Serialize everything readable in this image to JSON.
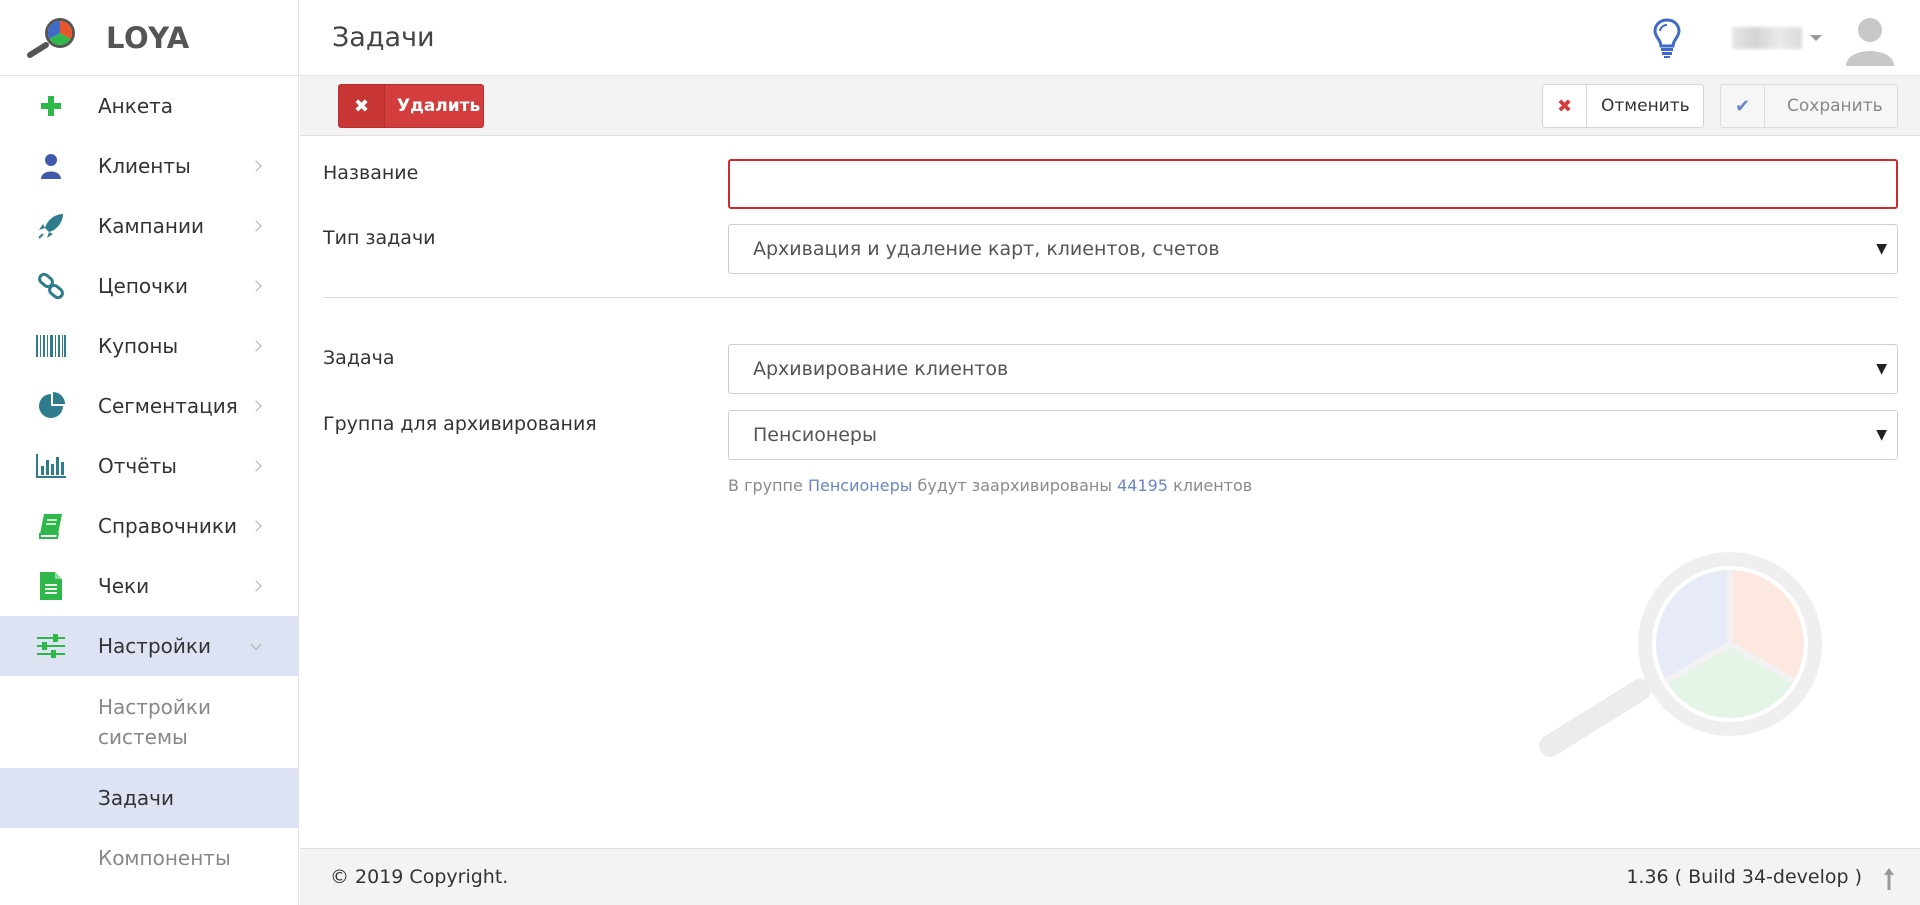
{
  "app": {
    "brand": "LOYA"
  },
  "header": {
    "title": "Задачи"
  },
  "sidebar": {
    "items": [
      {
        "label": "Анкета",
        "icon": "plus-icon",
        "color": "#2fb84a"
      },
      {
        "label": "Клиенты",
        "icon": "user-icon",
        "color": "#3f5aa8"
      },
      {
        "label": "Кампании",
        "icon": "rocket-icon",
        "color": "#2f7d8c"
      },
      {
        "label": "Цепочки",
        "icon": "chain-icon",
        "color": "#2f7d8c"
      },
      {
        "label": "Купоны",
        "icon": "barcode-icon",
        "color": "#2f7d8c"
      },
      {
        "label": "Сегментация",
        "icon": "pie-icon",
        "color": "#2f7d8c"
      },
      {
        "label": "Отчёты",
        "icon": "bar-chart-icon",
        "color": "#2f7d8c"
      },
      {
        "label": "Справочники",
        "icon": "book-icon",
        "color": "#2fb84a"
      },
      {
        "label": "Чеки",
        "icon": "document-icon",
        "color": "#2fb84a"
      },
      {
        "label": "Настройки",
        "icon": "sliders-icon",
        "color": "#2fb84a"
      }
    ],
    "subitems": [
      {
        "label": "Настройки системы"
      },
      {
        "label": "Задачи"
      },
      {
        "label": "Компоненты"
      }
    ]
  },
  "toolbar": {
    "delete_label": "Удалить",
    "cancel_label": "Отменить",
    "save_label": "Сохранить"
  },
  "form": {
    "name_label": "Название",
    "name_value": "",
    "task_type_label": "Тип задачи",
    "task_type_value": "Архивация и удаление карт, клиентов, счетов",
    "task_label": "Задача",
    "task_value": "Архивирование клиентов",
    "group_label": "Группа для архивирования",
    "group_value": "Пенсионеры",
    "hint": {
      "prefix": "В группе",
      "group": "Пенсионеры",
      "middle": "будут заархивированы",
      "count": "44195",
      "suffix": "клиентов"
    }
  },
  "footer": {
    "copyright": "© 2019 Copyright.",
    "version": "1.36 ( Build 34-develop )"
  },
  "colors": {
    "accent": "#d33d3d",
    "active_bg": "#dde3f3",
    "link": "#6b86c4"
  }
}
